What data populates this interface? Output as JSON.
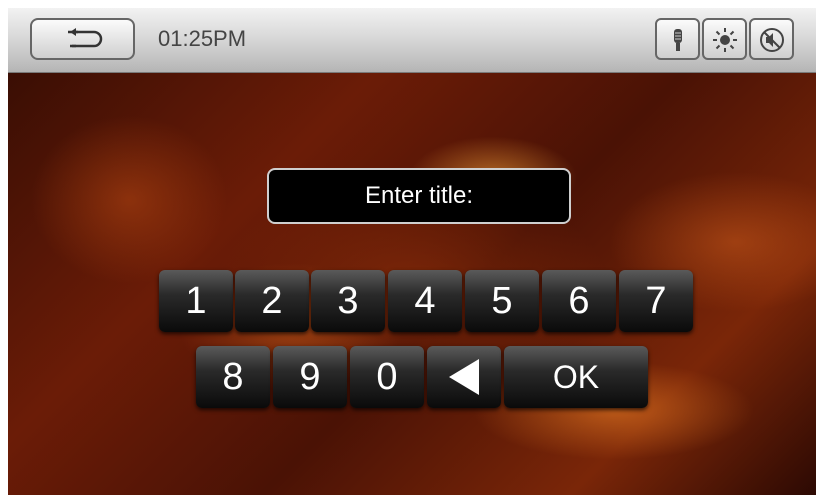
{
  "statusbar": {
    "time": "01:25PM",
    "icons": [
      "back-arrow-icon",
      "microphone-icon",
      "brightness-icon",
      "mute-icon"
    ]
  },
  "dialog": {
    "prompt": "Enter title:"
  },
  "keypad": {
    "row1": [
      "1",
      "2",
      "3",
      "4",
      "5",
      "6",
      "7"
    ],
    "row2": [
      "8",
      "9",
      "0"
    ],
    "backspace_icon": "left-triangle-icon",
    "ok_label": "OK"
  },
  "colors": {
    "key_face": "#1a1a1a",
    "prompt_bg": "#000000",
    "topbar": "#d9d9d9"
  }
}
